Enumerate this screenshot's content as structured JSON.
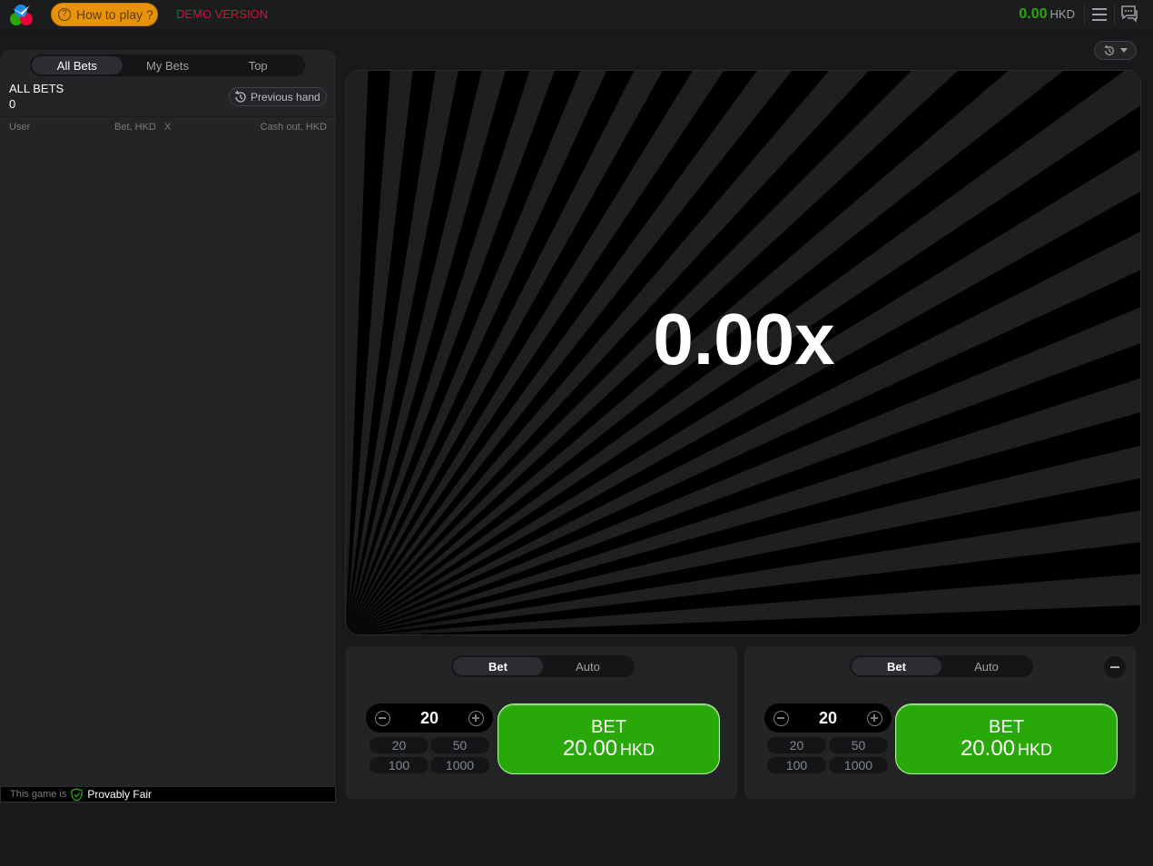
{
  "header": {
    "how_to_play": "How to play ?",
    "demo_label": "DEMO VERSION",
    "balance_value": "0.00",
    "balance_currency": "HKD"
  },
  "left_panel": {
    "tabs": [
      "All Bets",
      "My Bets",
      "Top"
    ],
    "active_tab": "All Bets",
    "title": "ALL BETS",
    "count": "0",
    "previous_hand": "Previous hand",
    "columns": {
      "user": "User",
      "bet": "Bet, HKD",
      "x": "X",
      "cashout": "Cash out, HKD"
    },
    "footer_prefix": "This game is",
    "footer_label": "Provably Fair"
  },
  "stage": {
    "multiplier": "0.00x"
  },
  "bet_panels": [
    {
      "tabs": [
        "Bet",
        "Auto"
      ],
      "active_tab": "Bet",
      "amount": "20",
      "quick": [
        "20",
        "50",
        "100",
        "1000"
      ],
      "bet_label": "BET",
      "bet_amount": "20.00",
      "bet_currency": "HKD"
    },
    {
      "tabs": [
        "Bet",
        "Auto"
      ],
      "active_tab": "Bet",
      "amount": "20",
      "quick": [
        "20",
        "50",
        "100",
        "1000"
      ],
      "bet_label": "BET",
      "bet_amount": "20.00",
      "bet_currency": "HKD"
    }
  ],
  "colors": {
    "accent_green": "#28a909",
    "demo_red": "#e50539",
    "how_to_play_orange": "#e69308"
  }
}
